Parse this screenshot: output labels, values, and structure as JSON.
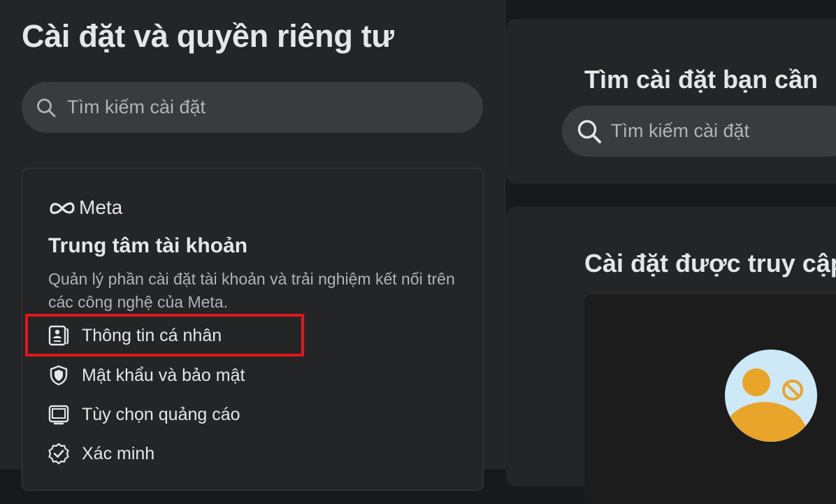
{
  "sidebar": {
    "title": "Cài đặt và quyền riêng tư",
    "search_placeholder": "Tìm kiếm cài đặt"
  },
  "accounts_center": {
    "brand": "Meta",
    "title": "Trung tâm tài khoản",
    "description": "Quản lý phần cài đặt tài khoản và trải nghiệm kết nối trên các công nghệ của Meta.",
    "items": [
      {
        "label": "Thông tin cá nhân",
        "icon": "id-card-icon",
        "highlighted": true
      },
      {
        "label": "Mật khẩu và bảo mật",
        "icon": "shield-icon"
      },
      {
        "label": "Tùy chọn quảng cáo",
        "icon": "monitor-icon"
      },
      {
        "label": "Xác minh",
        "icon": "verified-badge-icon"
      }
    ]
  },
  "main": {
    "search_title": "Tìm cài đặt bạn cần",
    "search_placeholder": "Tìm kiếm cài đặt",
    "recent_title": "Cài đặt được truy cập"
  },
  "colors": {
    "background": "#18191a",
    "panel": "#242526",
    "input": "#3a3b3c",
    "highlight_border": "#e4141b",
    "avatar_bg": "#cde8f6",
    "avatar_person": "#e9a52a"
  }
}
